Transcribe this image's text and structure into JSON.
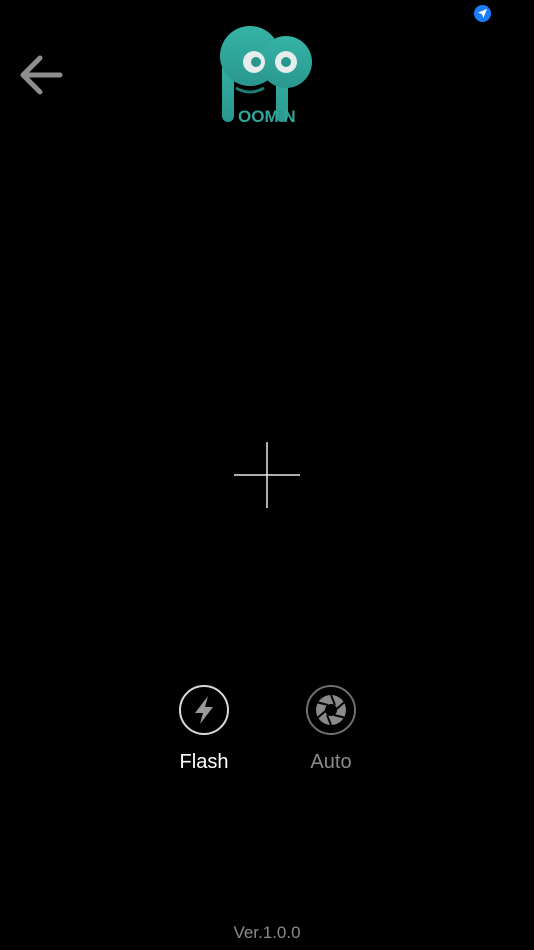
{
  "app": {
    "logo_text": "OOM N",
    "brand_color": "#2fa79d"
  },
  "header": {
    "back_icon": "arrow-left-icon",
    "status_icon": "location-arrow-icon",
    "status_color": "#1a7cff"
  },
  "viewfinder": {
    "focus_icon": "crosshair-icon"
  },
  "controls": {
    "flash": {
      "label": "Flash",
      "icon": "lightning-bolt-icon"
    },
    "auto": {
      "label": "Auto",
      "icon": "aperture-icon"
    }
  },
  "footer": {
    "version": "Ver.1.0.0"
  }
}
